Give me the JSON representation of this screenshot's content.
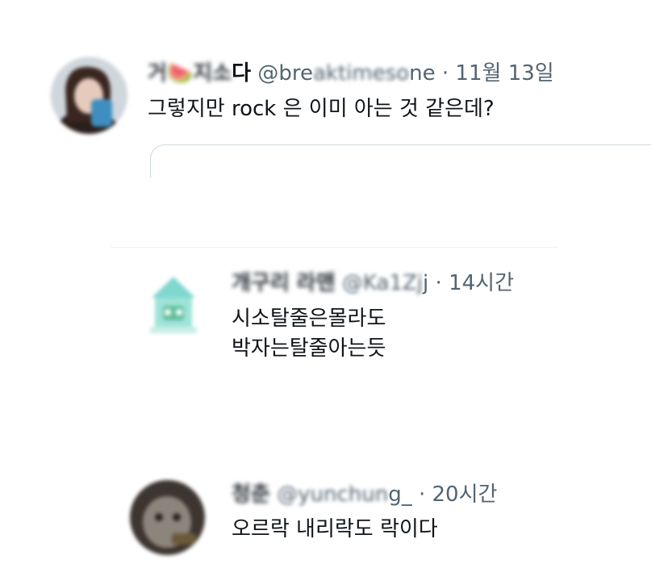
{
  "tweets": [
    {
      "display_name_blurred": "거🍉지소",
      "display_name_visible": "다",
      "handle_visible_start": "@bre",
      "handle_blurred": "aktimeso",
      "handle_visible_end": "ne",
      "separator": " · ",
      "timestamp": "11월 13일",
      "text_lines": [
        "그렇지만 rock 은 이미 아는 것 같은데?"
      ],
      "avatar_icon": "profile-photo-blurred"
    },
    {
      "display_name_blurred": "개구리 라맨",
      "handle_blurred": "@Ka1Zj",
      "handle_visible_end": "j",
      "separator": " · ",
      "timestamp": "14시간",
      "text_lines": [
        "시소탈줄은몰라도",
        "박자는탈줄아는듯"
      ],
      "avatar_icon": "frog-house-avatar-blurred"
    },
    {
      "display_name_blurred": "청춘",
      "handle_blurred": "@yunchun",
      "handle_visible_end": "g_",
      "separator": " · ",
      "timestamp": "20시간",
      "text_lines": [
        "오르락 내리락도 락이다"
      ],
      "avatar_icon": "profile-photo-dark-blurred"
    }
  ],
  "colors": {
    "text_primary": "#0f1419",
    "text_secondary": "#536471",
    "divider": "#eff3f4",
    "quote_border": "#cfd9de"
  }
}
